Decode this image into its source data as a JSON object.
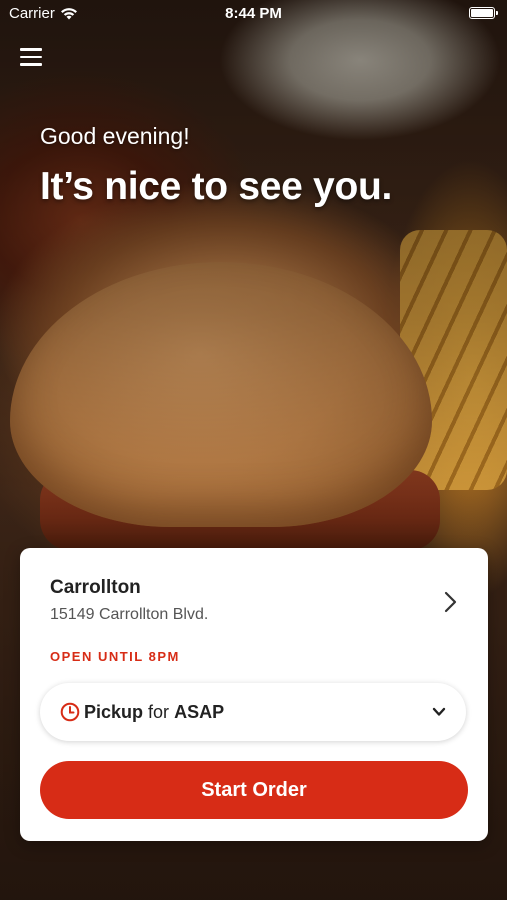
{
  "status_bar": {
    "carrier": "Carrier",
    "time": "8:44 PM"
  },
  "greeting": "Good evening!",
  "headline": "It’s nice to see you.",
  "store": {
    "name": "Carrollton",
    "address": "15149 Carrollton Blvd.",
    "hours": "OPEN UNTIL 8PM"
  },
  "order_mode": {
    "mode": "Pickup",
    "connector": "for",
    "time": "ASAP"
  },
  "actions": {
    "start_order": "Start Order"
  },
  "colors": {
    "accent": "#d72c16"
  },
  "icons": {
    "menu": "menu-icon",
    "wifi": "wifi-icon",
    "battery": "battery-icon",
    "store_chevron": "chevron-right-icon",
    "clock": "clock-icon",
    "dropdown": "chevron-down-icon"
  }
}
